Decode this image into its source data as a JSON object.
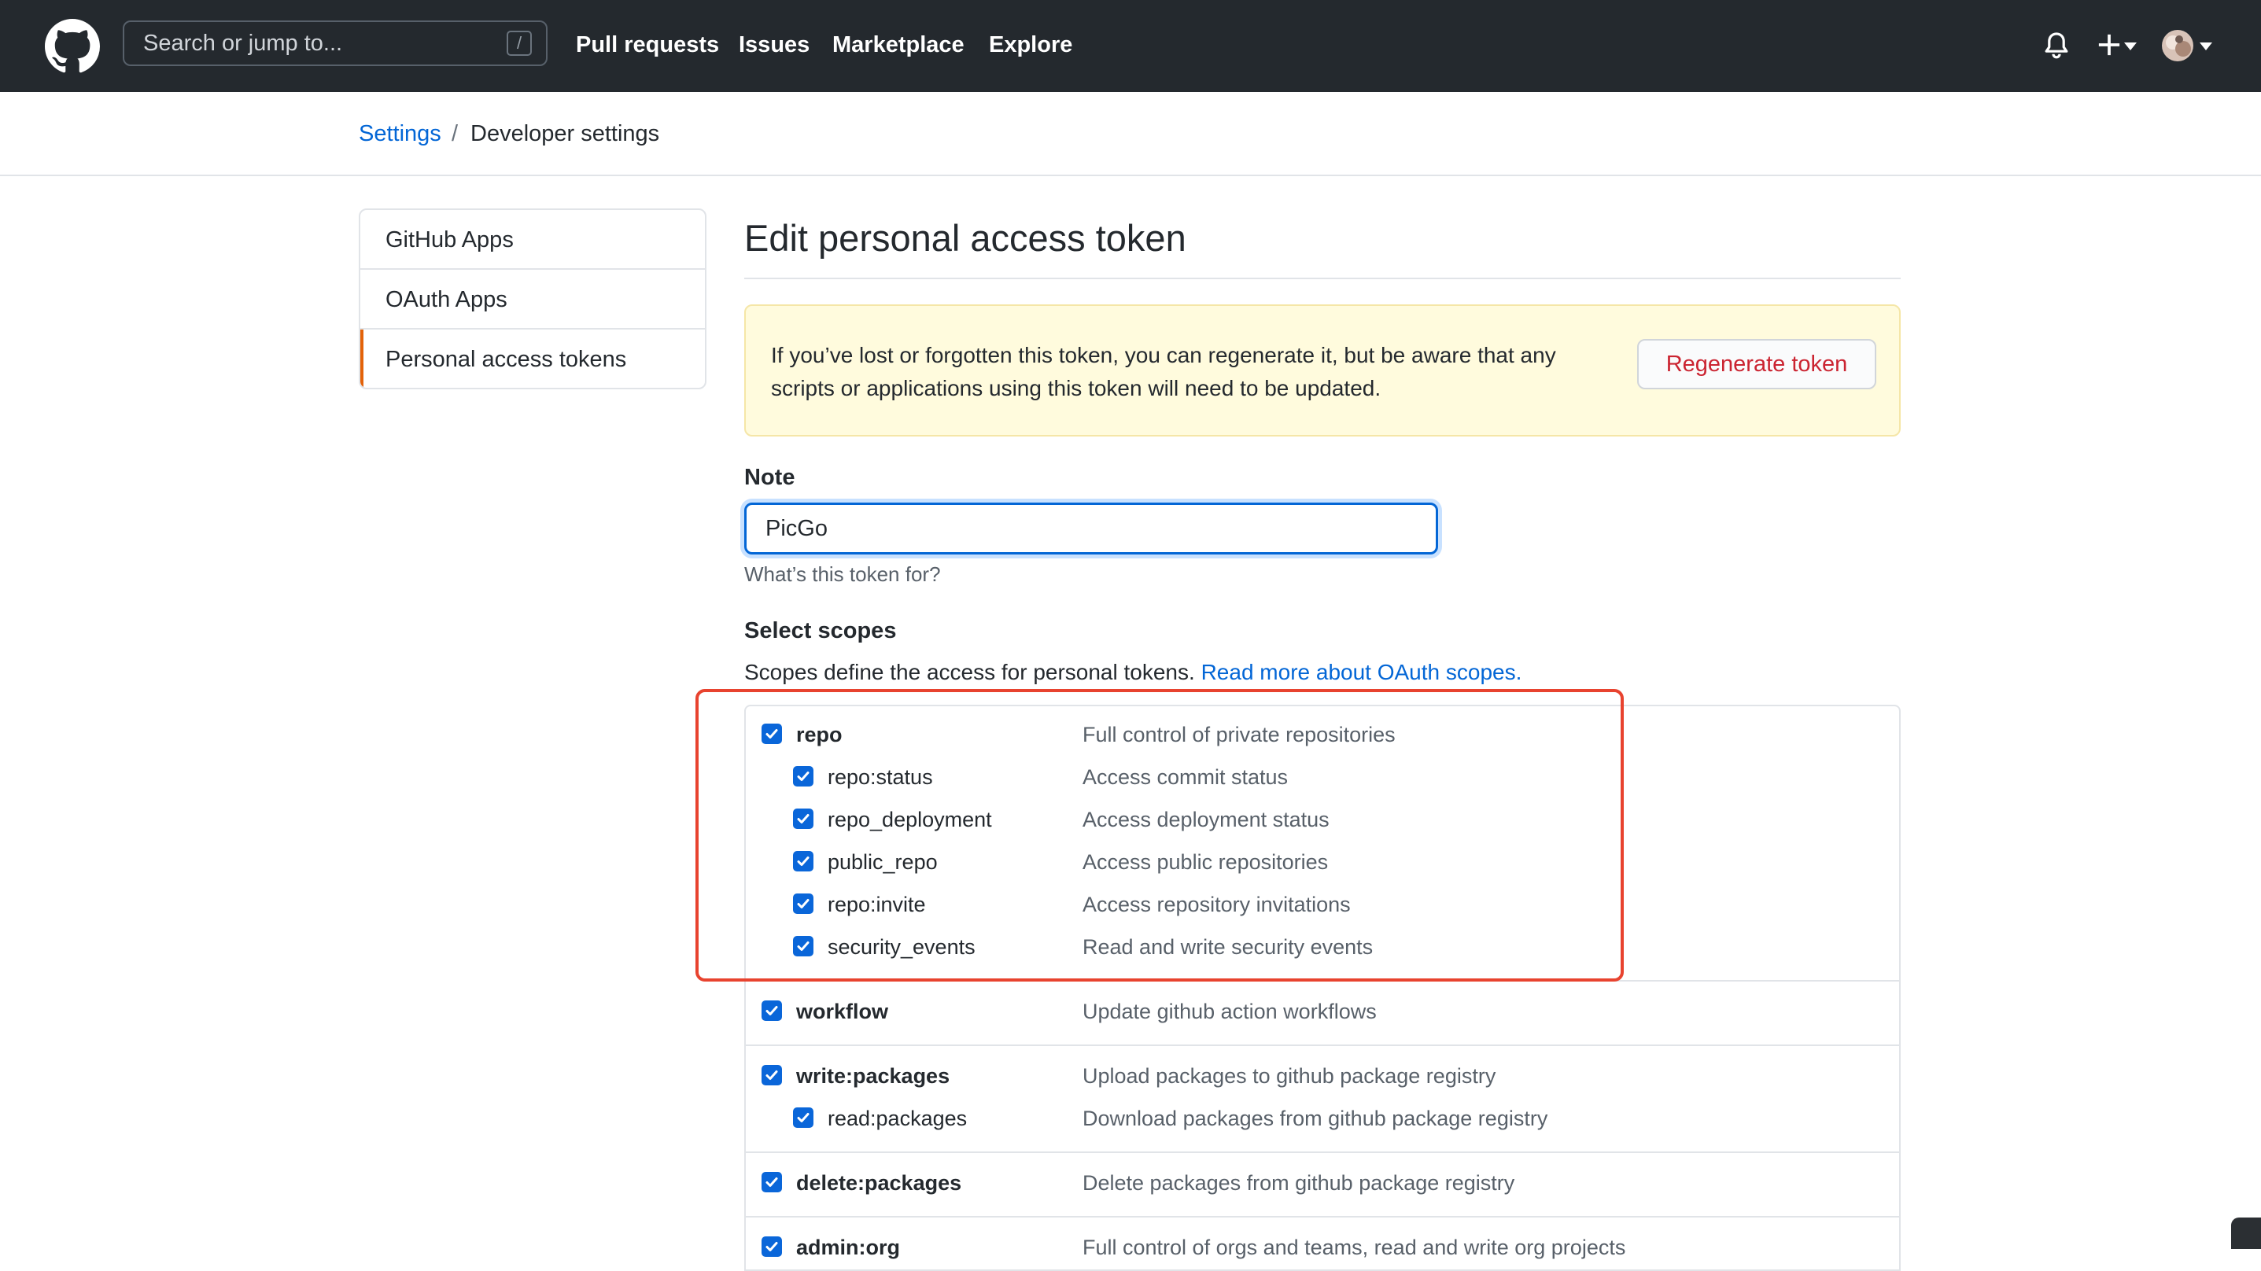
{
  "header": {
    "search_placeholder": "Search or jump to...",
    "search_shortcut": "/",
    "nav": [
      "Pull requests",
      "Issues",
      "Marketplace",
      "Explore"
    ]
  },
  "breadcrumb": {
    "root": "Settings",
    "separator": "/",
    "current": "Developer settings"
  },
  "sidebar": {
    "items": [
      "GitHub Apps",
      "OAuth Apps",
      "Personal access tokens"
    ],
    "active_index": 2
  },
  "main": {
    "title": "Edit personal access token",
    "flash_text": "If you’ve lost or forgotten this token, you can regenerate it, but be aware that any scripts or applications using this token will need to be updated.",
    "regenerate_label": "Regenerate token",
    "note_label": "Note",
    "note_value": "PicGo",
    "note_hint": "What’s this token for?",
    "scopes_heading": "Select scopes",
    "scopes_desc": "Scopes define the access for personal tokens.",
    "scopes_link": "Read more about OAuth scopes."
  },
  "scopes": [
    {
      "name": "repo",
      "desc": "Full control of private repositories",
      "checked": true,
      "children": [
        {
          "name": "repo:status",
          "desc": "Access commit status",
          "checked": true
        },
        {
          "name": "repo_deployment",
          "desc": "Access deployment status",
          "checked": true
        },
        {
          "name": "public_repo",
          "desc": "Access public repositories",
          "checked": true
        },
        {
          "name": "repo:invite",
          "desc": "Access repository invitations",
          "checked": true
        },
        {
          "name": "security_events",
          "desc": "Read and write security events",
          "checked": true
        }
      ]
    },
    {
      "name": "workflow",
      "desc": "Update github action workflows",
      "checked": true,
      "children": []
    },
    {
      "name": "write:packages",
      "desc": "Upload packages to github package registry",
      "checked": true,
      "children": [
        {
          "name": "read:packages",
          "desc": "Download packages from github package registry",
          "checked": true
        }
      ]
    },
    {
      "name": "delete:packages",
      "desc": "Delete packages from github package registry",
      "checked": true,
      "children": []
    },
    {
      "name": "admin:org",
      "desc": "Full control of orgs and teams, read and write org projects",
      "checked": true,
      "children": []
    }
  ],
  "colors": {
    "header_bg": "#24292e",
    "link": "#0366d6",
    "danger": "#cb2431",
    "flash_bg": "#fffbdd",
    "checkbox": "#0a66d9",
    "highlight": "#e8432f",
    "active_tab": "#e36209"
  }
}
